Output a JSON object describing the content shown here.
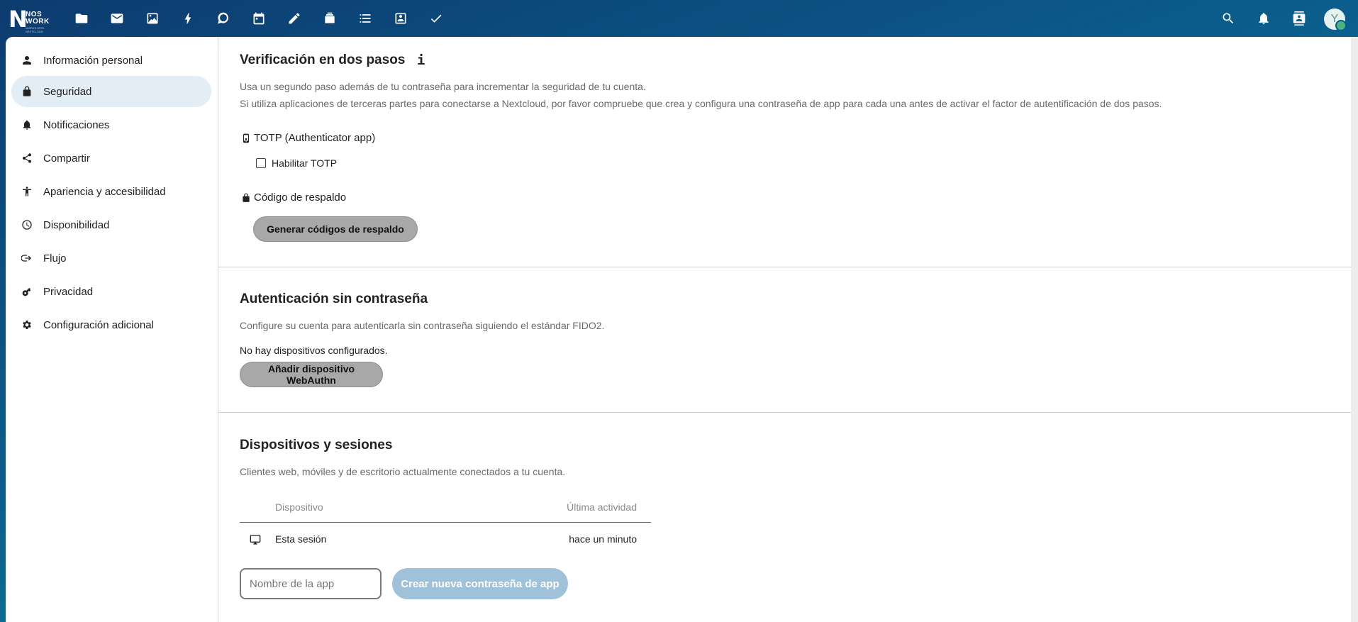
{
  "header": {
    "logo_letter": "N",
    "logo_line1": "NOS",
    "logo_line2": "WORK",
    "logo_tagline": "WORKS WITH NEXTCLOUD",
    "apps": [
      {
        "name": "files-icon"
      },
      {
        "name": "mail-icon"
      },
      {
        "name": "photos-icon"
      },
      {
        "name": "activity-icon"
      },
      {
        "name": "talk-icon"
      },
      {
        "name": "calendar-icon"
      },
      {
        "name": "notes-icon"
      },
      {
        "name": "deck-icon"
      },
      {
        "name": "tasks-icon"
      },
      {
        "name": "contacts-app-icon"
      },
      {
        "name": "checkmark-icon"
      }
    ],
    "avatar_initial": "Y"
  },
  "sidebar": {
    "items": [
      {
        "label": "Información personal",
        "icon": "user-icon"
      },
      {
        "label": "Seguridad",
        "icon": "lock-icon",
        "active": true
      },
      {
        "label": "Notificaciones",
        "icon": "bell-icon"
      },
      {
        "label": "Compartir",
        "icon": "share-icon"
      },
      {
        "label": "Apariencia y accesibilidad",
        "icon": "accessibility-icon"
      },
      {
        "label": "Disponibilidad",
        "icon": "clock-icon"
      },
      {
        "label": "Flujo",
        "icon": "flow-icon"
      },
      {
        "label": "Privacidad",
        "icon": "key-icon"
      },
      {
        "label": "Configuración adicional",
        "icon": "gear-icon"
      }
    ]
  },
  "two_factor": {
    "title": "Verificación en dos pasos",
    "info_glyph": "i",
    "desc1": "Usa un segundo paso además de tu contraseña para incrementar la seguridad de tu cuenta.",
    "desc2": "Si utiliza aplicaciones de terceras partes para conectarse a Nextcloud, por favor compruebe que crea y configura una contraseña de app para cada una antes de activar el factor de autentificación de dos pasos.",
    "totp_title": "TOTP (Authenticator app)",
    "totp_checkbox_label": "Habilitar TOTP",
    "backup_title": "Código de respaldo",
    "backup_button": "Generar códigos de respaldo"
  },
  "passwordless": {
    "title": "Autenticación sin contraseña",
    "desc": "Configure su cuenta para autenticarla sin contraseña siguiendo el estándar FIDO2.",
    "no_devices": "No hay dispositivos configurados.",
    "add_button": "Añadir dispositivo WebAuthn"
  },
  "sessions": {
    "title": "Dispositivos y sesiones",
    "desc": "Clientes web, móviles y de escritorio actualmente conectados a tu cuenta.",
    "col_device": "Dispositivo",
    "col_activity": "Última actividad",
    "rows": [
      {
        "device": "Esta sesión",
        "activity": "hace un minuto"
      }
    ],
    "app_name_placeholder": "Nombre de la app",
    "create_button": "Crear nueva contraseña de app"
  }
}
